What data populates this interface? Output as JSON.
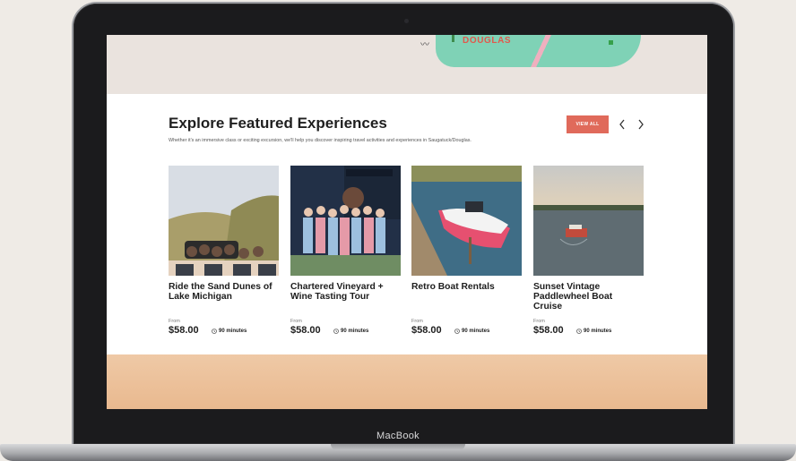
{
  "device": {
    "brand": "MacBook"
  },
  "hero_map": {
    "label": "DOUGLAS"
  },
  "section": {
    "title": "Explore Featured Experiences",
    "subtitle": "Whether it's an immersive class or exciting excursion, we'll help you discover inspiring travel activities and experiences in Saugatuck/Douglas.",
    "view_all_label": "VIEW ALL"
  },
  "cards": [
    {
      "title": "Ride the Sand Dunes of Lake Michigan",
      "from_label": "From",
      "price": "$58.00",
      "duration": "90 minutes"
    },
    {
      "title": "Chartered Vineyard + Wine Tasting Tour",
      "from_label": "From",
      "price": "$58.00",
      "duration": "90 minutes"
    },
    {
      "title": "Retro Boat Rentals",
      "from_label": "From",
      "price": "$58.00",
      "duration": "90 minutes"
    },
    {
      "title": "Sunset Vintage Paddlewheel Boat Cruise",
      "from_label": "From",
      "price": "$58.00",
      "duration": "90 minutes"
    }
  ],
  "colors": {
    "accent": "#e06a5b",
    "background": "#efebe6"
  }
}
